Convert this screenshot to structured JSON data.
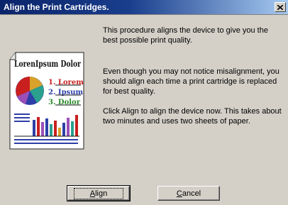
{
  "window": {
    "title": "Align the Print Cartridges."
  },
  "content": {
    "paragraph1": "This procedure aligns the device to give you the best possible print quality.",
    "paragraph2": "Even though you may not notice misalignment, you should align each time a print cartridge is replaced for best quality.",
    "paragraph3": "Click Align to align the device now.  This takes about two minutes and uses two sheets of paper."
  },
  "illustration": {
    "heading": "LorenIpsum Dolor",
    "items": [
      "1. Lorem",
      "2. Ipsum",
      "3. Dolor"
    ]
  },
  "buttons": {
    "align": {
      "mnemonic": "A",
      "rest": "lign"
    },
    "cancel": {
      "mnemonic": "C",
      "rest": "ancel"
    }
  },
  "colors": {
    "titlebar_start": "#0a246a",
    "titlebar_end": "#a6caf0",
    "dialog_bg": "#d4d0c8"
  }
}
